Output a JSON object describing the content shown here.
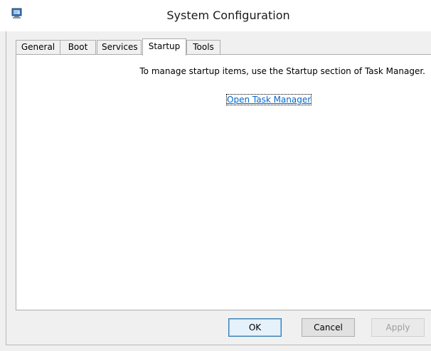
{
  "window": {
    "title": "System Configuration",
    "app_icon": "msconfig-icon"
  },
  "tabs": [
    {
      "label": "General"
    },
    {
      "label": "Boot"
    },
    {
      "label": "Services"
    },
    {
      "label": "Startup",
      "selected": true
    },
    {
      "label": "Tools"
    }
  ],
  "startup_panel": {
    "info_text": "To manage startup items, use the Startup section of Task Manager.",
    "link_text": "Open Task Manager"
  },
  "buttons": {
    "ok_label": "OK",
    "cancel_label": "Cancel",
    "apply_label": "Apply",
    "apply_enabled": false
  },
  "colors": {
    "link": "#0066cc",
    "window_bg": "#f0f0f0",
    "panel_bg": "#ffffff"
  }
}
